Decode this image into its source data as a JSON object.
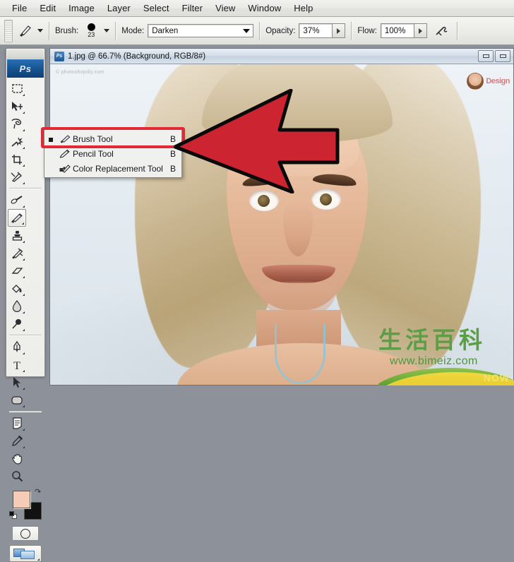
{
  "app": {
    "name": "Adobe Photoshop",
    "logo_text": "Ps"
  },
  "menubar": {
    "items": [
      {
        "label": "File"
      },
      {
        "label": "Edit"
      },
      {
        "label": "Image"
      },
      {
        "label": "Layer"
      },
      {
        "label": "Select"
      },
      {
        "label": "Filter"
      },
      {
        "label": "View"
      },
      {
        "label": "Window"
      },
      {
        "label": "Help"
      }
    ]
  },
  "options_bar": {
    "tool_preset_icon": "brush-tool-icon",
    "brush_label": "Brush:",
    "brush_size": "23",
    "mode_label": "Mode:",
    "mode_value": "Darken",
    "opacity_label": "Opacity:",
    "opacity_value": "37%",
    "flow_label": "Flow:",
    "flow_value": "100%",
    "airbrush_icon": "airbrush-icon"
  },
  "toolbox": {
    "logo": "Ps",
    "tools": [
      {
        "name": "rectangular-marquee-tool",
        "has_flyout": true
      },
      {
        "name": "move-tool",
        "has_flyout": true
      },
      {
        "name": "lasso-tool",
        "has_flyout": true
      },
      {
        "name": "magic-wand-tool",
        "has_flyout": true
      },
      {
        "name": "crop-tool",
        "has_flyout": true
      },
      {
        "name": "slice-tool",
        "has_flyout": true
      },
      {
        "name": "healing-brush-tool",
        "has_flyout": true
      },
      {
        "name": "brush-tool",
        "has_flyout": true,
        "selected": true
      },
      {
        "name": "clone-stamp-tool",
        "has_flyout": true
      },
      {
        "name": "history-brush-tool",
        "has_flyout": true
      },
      {
        "name": "eraser-tool",
        "has_flyout": true
      },
      {
        "name": "gradient-tool",
        "has_flyout": true
      },
      {
        "name": "blur-tool",
        "has_flyout": true
      },
      {
        "name": "dodge-tool",
        "has_flyout": true
      },
      {
        "name": "pen-tool",
        "has_flyout": true
      },
      {
        "name": "type-tool",
        "has_flyout": true
      },
      {
        "name": "path-selection-tool",
        "has_flyout": true
      },
      {
        "name": "shape-tool",
        "has_flyout": true
      },
      {
        "name": "notes-tool",
        "has_flyout": true
      },
      {
        "name": "eyedropper-tool",
        "has_flyout": true
      },
      {
        "name": "hand-tool",
        "has_flyout": false
      },
      {
        "name": "zoom-tool",
        "has_flyout": false
      }
    ],
    "foreground_color": "#f5cdb6",
    "background_color": "#111111",
    "quick_mask": "quick-mask-mode",
    "screen_mode": "screen-mode-button"
  },
  "document": {
    "icon": "Ps",
    "title": "1.jpg @ 66.7% (Background, RGB/8#)",
    "filename": "1.jpg",
    "zoom": "66.7%",
    "layer": "Background",
    "color_mode": "RGB/8#",
    "window_buttons": [
      {
        "name": "minimize-button"
      },
      {
        "name": "maximize-button"
      }
    ],
    "canvas_watermark_topleft": "© photoshopdiy.com",
    "canvas_badge_text": "Design"
  },
  "flyout_menu": {
    "items": [
      {
        "label": "Brush Tool",
        "shortcut": "B",
        "icon": "brush-tool-icon",
        "selected": true
      },
      {
        "label": "Pencil Tool",
        "shortcut": "B",
        "icon": "pencil-tool-icon",
        "selected": false
      },
      {
        "label": "Color Replacement Tool",
        "shortcut": "B",
        "icon": "color-replacement-tool-icon",
        "selected": false
      }
    ],
    "highlight_color": "#e02a36"
  },
  "annotation": {
    "arrow_color": "#cc2431",
    "arrow_outline": "#000000",
    "arrow_direction": "left",
    "points_at": "Brush Tool"
  },
  "watermark": {
    "cjk_text": "生活百科",
    "url": "www.bimeiz.com",
    "corner_text": "NOW",
    "green": "#5a9e46",
    "yellow": "#f5d93f"
  }
}
